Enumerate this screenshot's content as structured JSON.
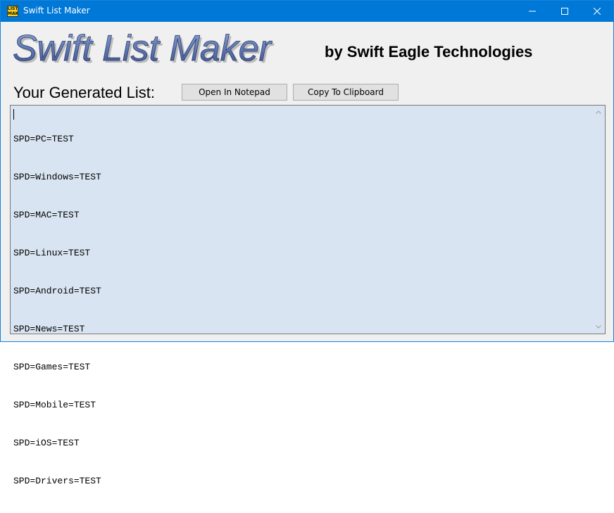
{
  "window": {
    "title": "Swift List Maker",
    "icon_text": "LIST MAKER"
  },
  "header": {
    "logo_text": "Swift List Maker",
    "byline": "by Swift Eagle Technologies"
  },
  "list_section": {
    "label": "Your Generated List:",
    "open_notepad_label": "Open In Notepad",
    "copy_clipboard_label": "Copy To Clipboard"
  },
  "output": {
    "lines": [
      "SPD=PC=TEST",
      "SPD=Windows=TEST",
      "SPD=MAC=TEST",
      "SPD=Linux=TEST",
      "SPD=Android=TEST",
      "SPD=News=TEST",
      "SPD=Games=TEST",
      "SPD=Mobile=TEST",
      "SPD=iOS=TEST",
      "SPD=Drivers=TEST"
    ]
  },
  "icons": {
    "app": "app-icon",
    "minimize": "minimize-icon",
    "maximize": "maximize-icon",
    "close": "close-icon",
    "scroll_up": "chevron-up-icon",
    "scroll_down": "chevron-down-icon"
  },
  "colors": {
    "titlebar": "#0078d7",
    "textarea_bg": "#d8e4f1",
    "logo_fill": "#5b74b0",
    "window_bg": "#f0f0f0"
  }
}
